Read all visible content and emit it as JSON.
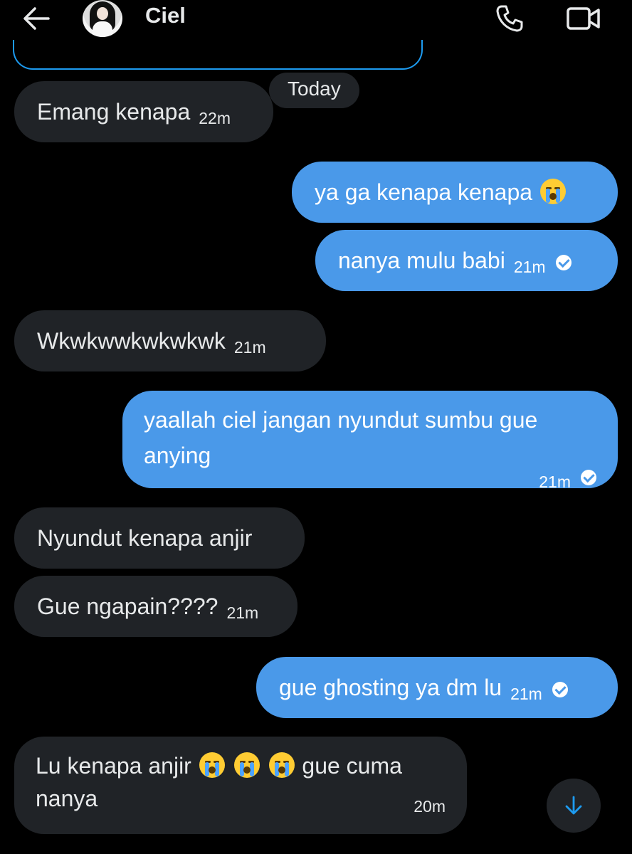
{
  "header": {
    "contact_name": "Ciel",
    "back_icon": "arrow-left-icon",
    "call_icon": "phone-icon",
    "video_icon": "video-camera-icon"
  },
  "date_separator": "Today",
  "messages": [
    {
      "from": "them",
      "text": "Emang kenapa",
      "time": "22m"
    },
    {
      "from": "me",
      "text": "ya ga kenapa kenapa",
      "emoji": "loudly-crying-face",
      "time": ""
    },
    {
      "from": "me",
      "text": "nanya mulu babi",
      "time": "21m",
      "read": true
    },
    {
      "from": "them",
      "text": "Wkwkwwkwkwkwk",
      "time": "21m"
    },
    {
      "from": "me",
      "text": "yaallah ciel jangan nyundut sumbu gue anying",
      "time": "21m",
      "read": true
    },
    {
      "from": "them",
      "text": "Nyundut kenapa anjir",
      "time": ""
    },
    {
      "from": "them",
      "text": "Gue ngapain????",
      "time": "21m"
    },
    {
      "from": "me",
      "text": "gue ghosting ya dm lu",
      "time": "21m",
      "read": true
    },
    {
      "from": "them",
      "text_before": "Lu kenapa anjir",
      "emoji_count": 3,
      "text_after": "gue cuma",
      "text_line2": "nanya",
      "time": "20m"
    }
  ],
  "scroll_down_icon": "arrow-down-icon",
  "colors": {
    "background": "#000000",
    "incoming_bubble": "#202327",
    "outgoing_bubble": "#4a99e9",
    "accent": "#1d9bf0"
  }
}
